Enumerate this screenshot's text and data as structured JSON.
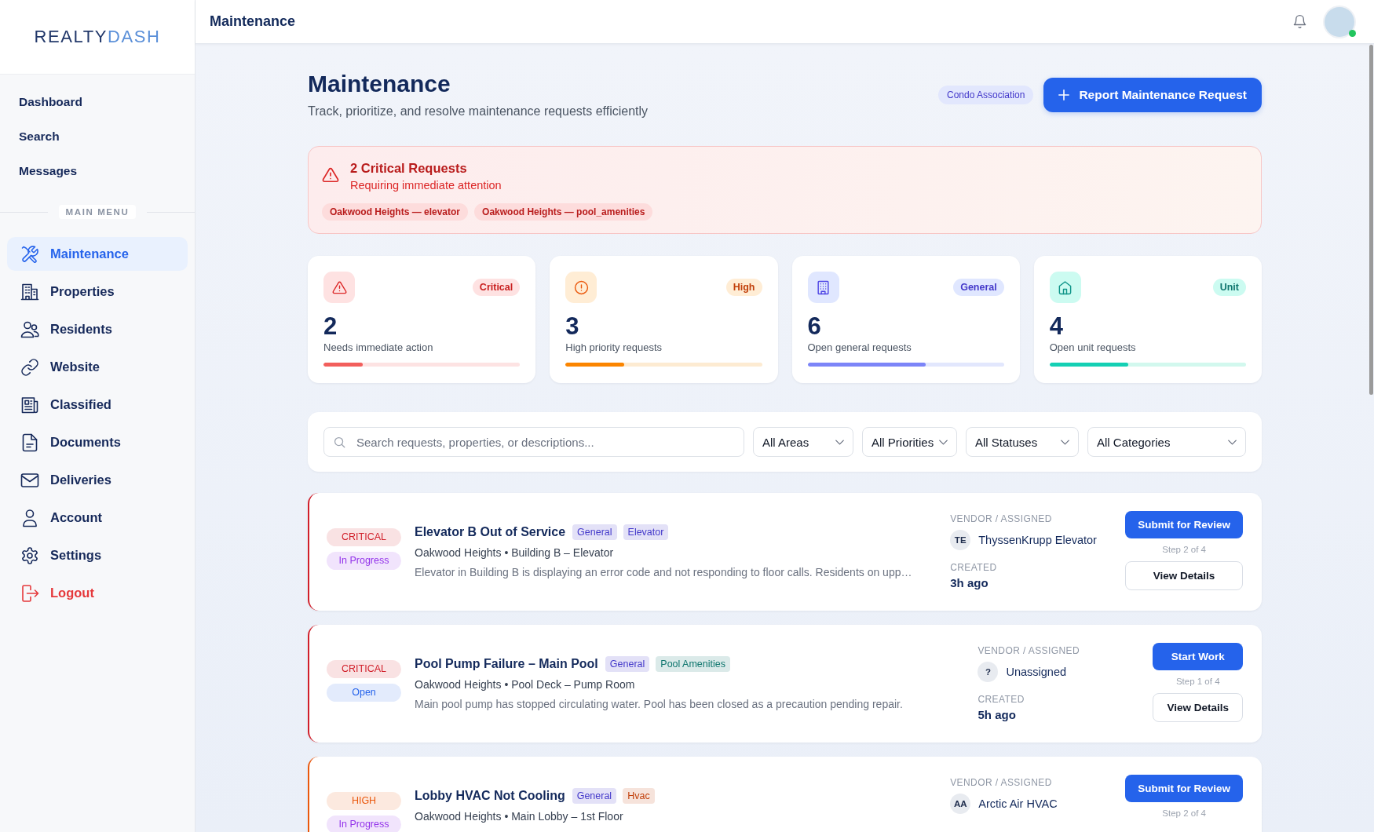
{
  "sidebar": {
    "logo": {
      "text": "REALTY",
      "accent": "DASH"
    },
    "quick_links": [
      {
        "label": "Dashboard",
        "selected": false
      },
      {
        "label": "Search",
        "selected": false
      },
      {
        "label": "Messages",
        "selected": false
      }
    ],
    "section_label": "MAIN MENU",
    "items": [
      {
        "kind": "maintenance",
        "label": "Maintenance",
        "selected": true
      },
      {
        "kind": "properties",
        "label": "Properties",
        "selected": false
      },
      {
        "kind": "residents",
        "label": "Residents",
        "selected": false
      },
      {
        "kind": "website",
        "label": "Website",
        "selected": false
      },
      {
        "kind": "classified",
        "label": "Classified",
        "selected": false
      },
      {
        "kind": "documents",
        "label": "Documents",
        "selected": false
      },
      {
        "kind": "deliveries",
        "label": "Deliveries",
        "selected": false
      },
      {
        "kind": "account",
        "label": "Account",
        "selected": false
      },
      {
        "kind": "settings",
        "label": "Settings",
        "selected": false
      },
      {
        "kind": "logout",
        "label": "Logout",
        "selected": false
      }
    ]
  },
  "header": {
    "title": "Maintenance",
    "user": {
      "online": true
    }
  },
  "page": {
    "title": "Maintenance",
    "subtitle": "Track, prioritize, and resolve maintenance requests efficiently",
    "badge": "Condo Association",
    "action": "Report Maintenance Request"
  },
  "alert": {
    "title": "2 Critical Requests",
    "subtitle": "Requiring immediate attention",
    "chips": [
      "Oakwood Heights — elevator",
      "Oakwood Heights — pool_amenities"
    ]
  },
  "stats": [
    {
      "kind": "critical",
      "badge": "Critical",
      "value": "2",
      "label": "Needs immediate action",
      "level": 0.2,
      "color": "#f25f5c"
    },
    {
      "kind": "high",
      "badge": "High",
      "value": "3",
      "label": "High priority requests",
      "level": 0.3,
      "color": "#fb8500"
    },
    {
      "kind": "general",
      "badge": "General",
      "value": "6",
      "label": "Open general requests",
      "level": 0.6,
      "color": "#7c85f8"
    },
    {
      "kind": "unit",
      "badge": "Unit",
      "value": "4",
      "label": "Open unit requests",
      "level": 0.4,
      "color": "#14d0b4"
    }
  ],
  "filters": {
    "search": {
      "placeholder": "Search requests, properties, or descriptions..."
    },
    "dropdowns": [
      {
        "value": "All Areas"
      },
      {
        "value": "All Priorities"
      },
      {
        "value": "All Statuses"
      },
      {
        "value": "All Categories"
      }
    ]
  },
  "requests": [
    {
      "priority": {
        "label": "CRITICAL",
        "color": "#d11f2a"
      },
      "status": {
        "label": "In Progress",
        "color": "#9333ea"
      },
      "title": "Elevator B Out of Service",
      "tags": [
        {
          "label": "General",
          "color": "#4338ca"
        },
        {
          "label": "Elevator",
          "color": "#4338ca"
        }
      ],
      "location": "Oakwood Heights • Building B – Elevator",
      "description": "Elevator in Building B is displaying an error code and not responding to floor calls. Residents on upp…",
      "vendor_label": "VENDOR / ASSIGNED",
      "vendor_initials": "TE",
      "vendor": "ThyssenKrupp Elevator",
      "created_label": "CREATED",
      "created": "3h ago",
      "primary_action": "Submit for Review",
      "step": "Step 2 of 4",
      "secondary_action": "View Details"
    },
    {
      "priority": {
        "label": "CRITICAL",
        "color": "#d11f2a"
      },
      "status": {
        "label": "Open",
        "color": "#2563eb"
      },
      "title": "Pool Pump Failure – Main Pool",
      "tags": [
        {
          "label": "General",
          "color": "#4338ca"
        },
        {
          "label": "Pool Amenities",
          "color": "#0f766e"
        }
      ],
      "location": "Oakwood Heights • Pool Deck – Pump Room",
      "description": "Main pool pump has stopped circulating water. Pool has been closed as a precaution pending repair.",
      "vendor_label": "VENDOR / ASSIGNED",
      "vendor_initials": "?",
      "vendor": "Unassigned",
      "created_label": "CREATED",
      "created": "5h ago",
      "primary_action": "Start Work",
      "step": "Step 1 of 4",
      "secondary_action": "View Details"
    },
    {
      "priority": {
        "label": "HIGH",
        "color": "#ea580c"
      },
      "status": {
        "label": "In Progress",
        "color": "#9333ea"
      },
      "title": "Lobby HVAC Not Cooling",
      "tags": [
        {
          "label": "General",
          "color": "#4338ca"
        },
        {
          "label": "Hvac",
          "color": "#c2410c"
        }
      ],
      "location": "Oakwood Heights • Main Lobby – 1st Floor",
      "vendor_label": "VENDOR / ASSIGNED",
      "vendor_initials": "AA",
      "vendor": "Arctic Air HVAC",
      "primary_action": "Submit for Review",
      "step": "Step 2 of 4"
    }
  ]
}
